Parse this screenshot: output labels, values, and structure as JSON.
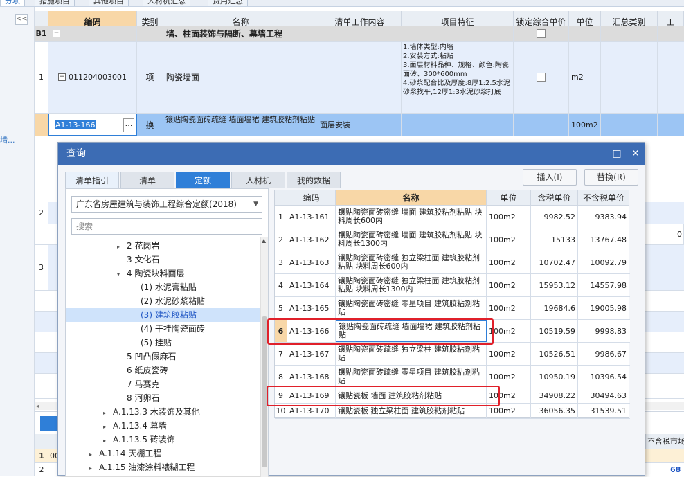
{
  "top_tabs": [
    "分项",
    "措施项目",
    "其他项目",
    "人材机汇总",
    "费用汇总"
  ],
  "left_strip": {
    "collapse": "<<",
    "label": "墙..."
  },
  "grid": {
    "columns": [
      "编码",
      "类别",
      "名称",
      "清单工作内容",
      "项目特征",
      "锁定综合单价",
      "单位",
      "汇总类别",
      "工"
    ],
    "rows": [
      {
        "num": "B1",
        "code": "",
        "type": "",
        "name": "墙、柱面装饰与隔断、幕墙工程",
        "content": "",
        "feature": "",
        "unit": ""
      },
      {
        "num": "1",
        "code": "011204003001",
        "type": "项",
        "name": "陶瓷墙面",
        "content": "",
        "feature": "1.墙体类型:内墙\n2.安装方式:粘贴\n3.面层材料品种、规格、颜色:陶瓷面砖、300*600mm\n4.砂浆配合比及厚度:8厚1:2.5水泥砂浆找平,12厚1:3水泥砂浆打底",
        "unit": "m2"
      },
      {
        "num": "",
        "code": "A1-13-166",
        "type": "换",
        "name": "镶贴陶瓷面砖疏缝 墙面墙裙 建筑胶粘剂粘贴",
        "content": "面层安装",
        "feature": "",
        "unit": "100m2"
      }
    ],
    "row_nums_lower": [
      "2",
      "3"
    ],
    "partial_text": "0",
    "bottom_header": "不含税市场",
    "bottom_row1": "1",
    "bottom_row1_code": "00",
    "bottom_row2": "2",
    "bottom_value": "68"
  },
  "dialog": {
    "title": "查询",
    "tabs": [
      "清单指引",
      "清单",
      "定额",
      "人材机",
      "我的数据"
    ],
    "active_tab": "定额",
    "insert_button": "插入(I)",
    "replace_button": "替换(R)",
    "library": "广东省房屋建筑与装饰工程综合定额(2018)",
    "search_placeholder": "搜索",
    "tree": [
      {
        "label": "2 花岗岩",
        "indent": 2,
        "arrow": "▸"
      },
      {
        "label": "3 文化石",
        "indent": 2,
        "arrow": ""
      },
      {
        "label": "4 陶瓷块料面层",
        "indent": 2,
        "arrow": "▾"
      },
      {
        "label": "(1) 水泥膏粘贴",
        "indent": 3,
        "arrow": ""
      },
      {
        "label": "(2) 水泥砂浆粘贴",
        "indent": 3,
        "arrow": ""
      },
      {
        "label": "(3) 建筑胶粘贴",
        "indent": 3,
        "arrow": "",
        "selected": true
      },
      {
        "label": "(4) 干挂陶瓷面砖",
        "indent": 3,
        "arrow": ""
      },
      {
        "label": "(5) 挂贴",
        "indent": 3,
        "arrow": ""
      },
      {
        "label": "5 凹凸假麻石",
        "indent": 2,
        "arrow": ""
      },
      {
        "label": "6 纸皮瓷砖",
        "indent": 2,
        "arrow": ""
      },
      {
        "label": "7 马赛克",
        "indent": 2,
        "arrow": ""
      },
      {
        "label": "8 河卵石",
        "indent": 2,
        "arrow": ""
      },
      {
        "label": "A.1.13.3 木装饰及其他",
        "indent": 1,
        "arrow": "▸"
      },
      {
        "label": "A.1.13.4 幕墙",
        "indent": 1,
        "arrow": "▸"
      },
      {
        "label": "A.1.13.5 砖装饰",
        "indent": 1,
        "arrow": "▸"
      },
      {
        "label": "A.1.14 天棚工程",
        "indent": 0,
        "arrow": "▸"
      },
      {
        "label": "A.1.15 油漆涂料裱糊工程",
        "indent": 0,
        "arrow": "▸"
      }
    ],
    "table_columns": [
      "编码",
      "名称",
      "单位",
      "含税单价",
      "不含税单价"
    ],
    "table_rows": [
      {
        "n": "1",
        "code": "A1-13-161",
        "name": "镶贴陶瓷面砖密缝 墙面 建筑胶粘剂粘贴 块料周长600内",
        "unit": "100m2",
        "tax": "9982.52",
        "notax": "9383.94"
      },
      {
        "n": "2",
        "code": "A1-13-162",
        "name": "镶贴陶瓷面砖密缝 墙面 建筑胶粘剂粘贴 块料周长1300内",
        "unit": "100m2",
        "tax": "15133",
        "notax": "13767.48"
      },
      {
        "n": "3",
        "code": "A1-13-163",
        "name": "镶贴陶瓷面砖密缝 独立梁柱面 建筑胶粘剂粘贴 块料周长600内",
        "unit": "100m2",
        "tax": "10702.47",
        "notax": "10092.79"
      },
      {
        "n": "4",
        "code": "A1-13-164",
        "name": "镶贴陶瓷面砖密缝 独立梁柱面 建筑胶粘剂粘贴 块料周长1300内",
        "unit": "100m2",
        "tax": "15953.12",
        "notax": "14557.98"
      },
      {
        "n": "5",
        "code": "A1-13-165",
        "name": "镶贴陶瓷面砖密缝 零星项目 建筑胶粘剂粘贴",
        "unit": "100m2",
        "tax": "19684.6",
        "notax": "19005.98"
      },
      {
        "n": "6",
        "code": "A1-13-166",
        "name": "镶贴陶瓷面砖疏缝 墙面墙裙 建筑胶粘剂粘贴",
        "unit": "100m2",
        "tax": "10519.59",
        "notax": "9998.83"
      },
      {
        "n": "7",
        "code": "A1-13-167",
        "name": "镶贴陶瓷面砖疏缝 独立梁柱 建筑胶粘剂粘贴",
        "unit": "100m2",
        "tax": "10526.51",
        "notax": "9986.67"
      },
      {
        "n": "8",
        "code": "A1-13-168",
        "name": "镶贴陶瓷面砖疏缝 零星项目 建筑胶粘剂粘贴",
        "unit": "100m2",
        "tax": "10950.19",
        "notax": "10396.54"
      },
      {
        "n": "9",
        "code": "A1-13-169",
        "name": "镶贴瓷板 墙面 建筑胶粘剂粘贴",
        "unit": "100m2",
        "tax": "34908.22",
        "notax": "30494.63"
      },
      {
        "n": "10",
        "code": "A1-13-170",
        "name": "镶贴瓷板 独立梁柱面 建筑胶粘剂粘贴",
        "unit": "100m2",
        "tax": "36056.35",
        "notax": "31539.51"
      }
    ]
  },
  "colors": {
    "accent": "#2f7fd8",
    "title_bar": "#3c6cb4",
    "selected_row": "#9cc5f4",
    "highlight": "#e0202a",
    "header_code": "#f8d7a7"
  }
}
